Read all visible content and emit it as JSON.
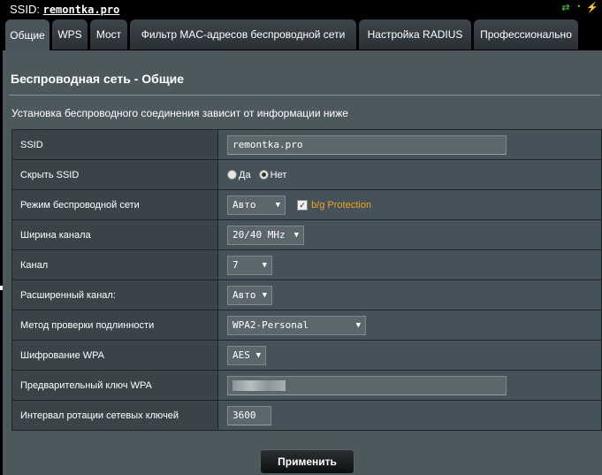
{
  "header": {
    "ssid_label": "SSID:",
    "ssid_value": "remontka.pro",
    "status_icons": [
      "network-status-icon",
      "wifi-status-icon",
      "usb-status-icon"
    ]
  },
  "tabs": [
    {
      "label": "Общие",
      "active": true
    },
    {
      "label": "WPS"
    },
    {
      "label": "Мост"
    },
    {
      "label": "Фильтр MAC-адресов беспроводной сети"
    },
    {
      "label": "Настройка RADIUS"
    },
    {
      "label": "Профессионально"
    }
  ],
  "panel": {
    "title": "Беспроводная сеть - Общие",
    "description": "Установка беспроводного соединения зависит от информации ниже"
  },
  "settings": {
    "ssid": {
      "label": "SSID",
      "value": "remontka.pro"
    },
    "hide_ssid": {
      "label": "Скрыть SSID",
      "yes": "Да",
      "no": "Нет",
      "selected": "no"
    },
    "mode": {
      "label": "Режим беспроводной сети",
      "value": "Авто",
      "bg_protection": "b/g Protection",
      "bg_checked": true
    },
    "bandwidth": {
      "label": "Ширина канала",
      "value": "20/40 MHz"
    },
    "channel": {
      "label": "Канал",
      "value": "7"
    },
    "ext_channel": {
      "label": "Расширенный канал:",
      "value": "Авто"
    },
    "auth": {
      "label": "Метод проверки подлинности",
      "value": "WPA2-Personal"
    },
    "wpa_enc": {
      "label": "Шифрование WPA",
      "value": "AES"
    },
    "wpa_key": {
      "label": "Предварительный ключ WPA"
    },
    "key_interval": {
      "label": "Интервал ротации сетевых ключей",
      "value": "3600"
    }
  },
  "apply_label": "Применить",
  "colors": {
    "accent_orange": "#f0a21e",
    "status_green": "#4ac94a"
  }
}
